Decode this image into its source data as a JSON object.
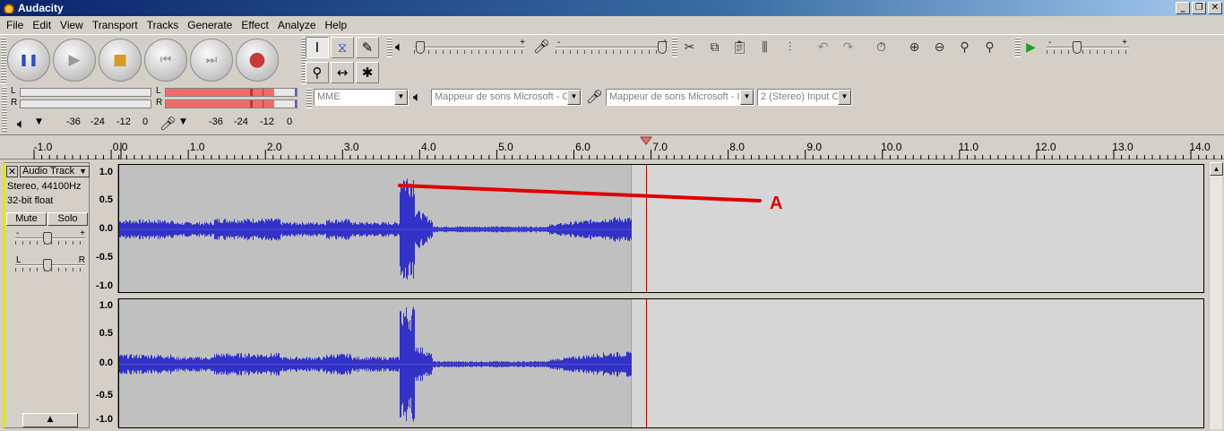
{
  "window": {
    "title": "Audacity",
    "min_glyph": "_",
    "max_glyph": "❐",
    "close_glyph": "✕"
  },
  "menu": [
    "File",
    "Edit",
    "View",
    "Transport",
    "Tracks",
    "Generate",
    "Effect",
    "Analyze",
    "Help"
  ],
  "transport": {
    "pause": "❚❚",
    "play": "▶",
    "stop": "■",
    "skip_start": "⏮",
    "skip_end": "⏭",
    "record": "●"
  },
  "tools": {
    "select": "I",
    "envelope": "⧖",
    "draw": "✎",
    "zoom": "⚲",
    "timeshift": "↔",
    "multi": "✱"
  },
  "meters": {
    "left_channel": "L",
    "right_channel": "R",
    "playback_scale": [
      "-36",
      "-24",
      "-12",
      "0"
    ],
    "record_scale": [
      "-36",
      "-24",
      "-12",
      "0"
    ],
    "record_level_l": 0.83,
    "record_level_r": 0.83
  },
  "mixer": {
    "minus": "-",
    "plus": "+",
    "output_level": 0.02,
    "input_level": 0.99
  },
  "play_at_speed": {
    "minus": "-",
    "plus": "+",
    "level": 0.35
  },
  "devices": {
    "host": "MME",
    "output": "Mappeur de sons Microsoft - O",
    "input": "Mappeur de sons Microsoft - Ir",
    "channels": "2 (Stereo) Input C"
  },
  "ruler": {
    "labels": [
      "-1.0",
      "0.0",
      "1.0",
      "2.0",
      "3.0",
      "4.0",
      "5.0",
      "6.0",
      "7.0",
      "8.0",
      "9.0",
      "10.0",
      "11.0",
      "12.0",
      "13.0",
      "14.0"
    ]
  },
  "track": {
    "name": "Audio Track",
    "info_line1": "Stereo, 44100Hz",
    "info_line2": "32-bit float",
    "mute": "Mute",
    "solo": "Solo",
    "gain_minus": "-",
    "gain_plus": "+",
    "pan_left": "L",
    "pan_right": "R",
    "collapse": "▲",
    "amp_labels": [
      "1.0",
      "0.5",
      "0.0",
      "-0.5",
      "-1.0"
    ]
  },
  "annotation": {
    "label": "A",
    "color": "#e00000"
  },
  "colors": {
    "wave": "#3232c8",
    "clip_bg": "#c0c0c0",
    "empty_bg": "#d6d6d6",
    "cursor": "#c00000"
  }
}
